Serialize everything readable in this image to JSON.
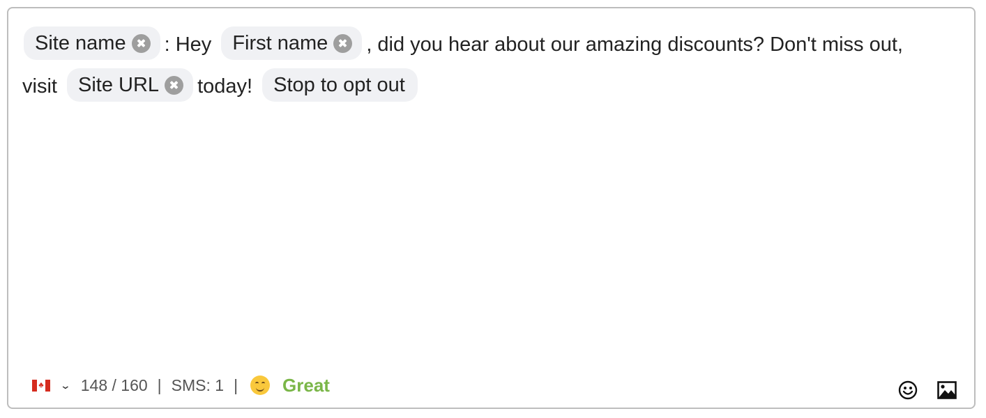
{
  "message": {
    "segments": [
      {
        "type": "chip",
        "label": "Site name",
        "removable": true
      },
      {
        "type": "text",
        "value": ": Hey"
      },
      {
        "type": "chip",
        "label": "First name",
        "removable": true
      },
      {
        "type": "text",
        "value": ", did you hear about our amazing discounts? Don't miss out, visit"
      },
      {
        "type": "chip",
        "label": "Site URL",
        "removable": true
      },
      {
        "type": "text",
        "value": "today!"
      },
      {
        "type": "chip",
        "label": "Stop to opt out",
        "removable": false
      }
    ]
  },
  "footer": {
    "country_flag": "canada-flag",
    "char_count": "148 / 160",
    "separator": "|",
    "sms_count": "SMS: 1",
    "quality_emoji": "smiling-face",
    "quality_label": "Great",
    "quality_color": "#7ab648"
  },
  "tools": {
    "emoji_icon": "emoji-icon",
    "image_icon": "image-icon"
  }
}
